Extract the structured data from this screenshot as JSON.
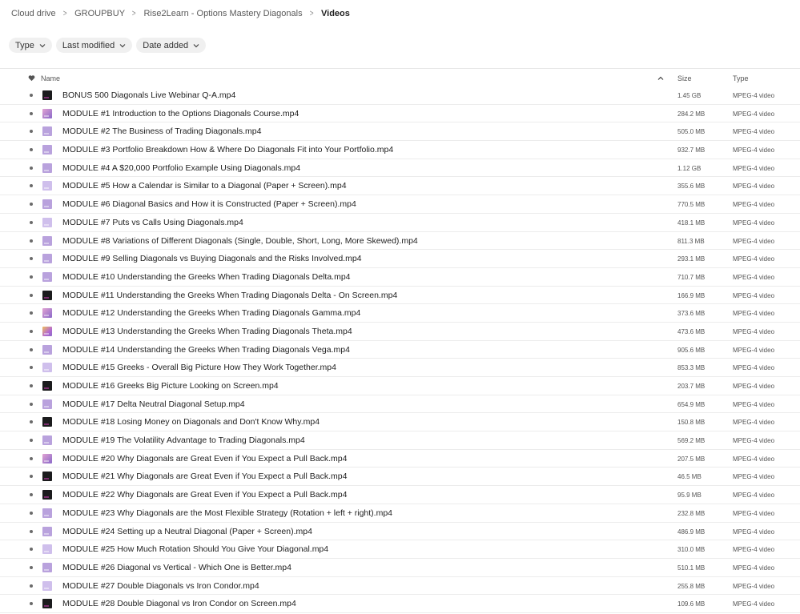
{
  "breadcrumb": [
    {
      "label": "Cloud drive"
    },
    {
      "label": "GROUPBUY"
    },
    {
      "label": "Rise2Learn - Options Mastery Diagonals"
    },
    {
      "label": "Videos"
    }
  ],
  "filters": [
    {
      "label": "Type"
    },
    {
      "label": "Last modified"
    },
    {
      "label": "Date added"
    }
  ],
  "columns": {
    "name": "Name",
    "size": "Size",
    "type": "Type"
  },
  "files": [
    {
      "name": "BONUS 500 Diagonals Live Webinar Q-A.mp4",
      "size": "1.45 GB",
      "type": "MPEG-4 video",
      "thumb": "dark"
    },
    {
      "name": "MODULE #1 Introduction to the Options Diagonals Course.mp4",
      "size": "284.2 MB",
      "type": "MPEG-4 video",
      "thumb": "pink"
    },
    {
      "name": "MODULE #2 The Business of Trading Diagonals.mp4",
      "size": "505.0 MB",
      "type": "MPEG-4 video",
      "thumb": "purple"
    },
    {
      "name": "MODULE #3 Portfolio Breakdown How & Where Do Diagonals Fit into Your Portfolio.mp4",
      "size": "932.7 MB",
      "type": "MPEG-4 video",
      "thumb": "purple"
    },
    {
      "name": "MODULE #4 A $20,000 Portfolio Example Using Diagonals.mp4",
      "size": "1.12 GB",
      "type": "MPEG-4 video",
      "thumb": "purple"
    },
    {
      "name": "MODULE #5 How a Calendar is Similar to a Diagonal (Paper + Screen).mp4",
      "size": "355.6 MB",
      "type": "MPEG-4 video",
      "thumb": "lavender"
    },
    {
      "name": "MODULE #6 Diagonal Basics and How it is Constructed (Paper + Screen).mp4",
      "size": "770.5 MB",
      "type": "MPEG-4 video",
      "thumb": "purple"
    },
    {
      "name": "MODULE #7 Puts vs Calls Using Diagonals.mp4",
      "size": "418.1 MB",
      "type": "MPEG-4 video",
      "thumb": "lavender"
    },
    {
      "name": "MODULE #8 Variations of Different Diagonals (Single, Double, Short, Long, More Skewed).mp4",
      "size": "811.3 MB",
      "type": "MPEG-4 video",
      "thumb": "purple"
    },
    {
      "name": "MODULE #9 Selling Diagonals vs Buying Diagonals and the Risks Involved.mp4",
      "size": "293.1 MB",
      "type": "MPEG-4 video",
      "thumb": "purple"
    },
    {
      "name": "MODULE #10 Understanding the Greeks When Trading Diagonals Delta.mp4",
      "size": "710.7 MB",
      "type": "MPEG-4 video",
      "thumb": "purple"
    },
    {
      "name": "MODULE #11 Understanding the Greeks When Trading Diagonals Delta - On Screen.mp4",
      "size": "166.9 MB",
      "type": "MPEG-4 video",
      "thumb": "dark"
    },
    {
      "name": "MODULE #12 Understanding the Greeks When Trading Diagonals Gamma.mp4",
      "size": "373.6 MB",
      "type": "MPEG-4 video",
      "thumb": "pink"
    },
    {
      "name": "MODULE #13 Understanding the Greeks When Trading Diagonals Theta.mp4",
      "size": "473.6 MB",
      "type": "MPEG-4 video",
      "thumb": "mixed"
    },
    {
      "name": "MODULE #14 Understanding the Greeks When Trading Diagonals Vega.mp4",
      "size": "905.6 MB",
      "type": "MPEG-4 video",
      "thumb": "purple"
    },
    {
      "name": "MODULE #15 Greeks - Overall Big Picture How They Work Together.mp4",
      "size": "853.3 MB",
      "type": "MPEG-4 video",
      "thumb": "lavender"
    },
    {
      "name": "MODULE #16 Greeks Big Picture Looking on Screen.mp4",
      "size": "203.7 MB",
      "type": "MPEG-4 video",
      "thumb": "dark"
    },
    {
      "name": "MODULE #17 Delta Neutral Diagonal Setup.mp4",
      "size": "654.9 MB",
      "type": "MPEG-4 video",
      "thumb": "purple"
    },
    {
      "name": "MODULE #18 Losing Money on Diagonals and Don't Know Why.mp4",
      "size": "150.8 MB",
      "type": "MPEG-4 video",
      "thumb": "dark"
    },
    {
      "name": "MODULE #19 The Volatility Advantage to Trading Diagonals.mp4",
      "size": "569.2 MB",
      "type": "MPEG-4 video",
      "thumb": "purple"
    },
    {
      "name": "MODULE #20 Why Diagonals are Great Even if You Expect a Pull Back.mp4",
      "size": "207.5 MB",
      "type": "MPEG-4 video",
      "thumb": "pink"
    },
    {
      "name": "MODULE #21 Why Diagonals are Great Even if You Expect a Pull Back.mp4",
      "size": "46.5 MB",
      "type": "MPEG-4 video",
      "thumb": "dark"
    },
    {
      "name": "MODULE #22 Why Diagonals are Great Even if You Expect a Pull Back.mp4",
      "size": "95.9 MB",
      "type": "MPEG-4 video",
      "thumb": "dark"
    },
    {
      "name": "MODULE #23 Why Diagonals are the Most Flexible Strategy (Rotation + left + right).mp4",
      "size": "232.8 MB",
      "type": "MPEG-4 video",
      "thumb": "purple"
    },
    {
      "name": "MODULE #24 Setting up a Neutral Diagonal (Paper + Screen).mp4",
      "size": "486.9 MB",
      "type": "MPEG-4 video",
      "thumb": "purple"
    },
    {
      "name": "MODULE #25 How Much Rotation Should You Give Your Diagonal.mp4",
      "size": "310.0 MB",
      "type": "MPEG-4 video",
      "thumb": "lavender"
    },
    {
      "name": "MODULE #26 Diagonal vs Vertical - Which One is Better.mp4",
      "size": "510.1 MB",
      "type": "MPEG-4 video",
      "thumb": "purple"
    },
    {
      "name": "MODULE #27 Double Diagonals vs Iron Condor.mp4",
      "size": "255.8 MB",
      "type": "MPEG-4 video",
      "thumb": "lavender"
    },
    {
      "name": "MODULE #28 Double Diagonal vs Iron Condor on Screen.mp4",
      "size": "109.6 MB",
      "type": "MPEG-4 video",
      "thumb": "dark"
    }
  ]
}
